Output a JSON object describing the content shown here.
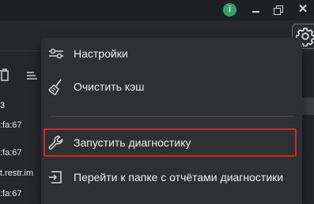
{
  "window": {
    "info_badge": "i",
    "controls": {
      "minimize_icon": "minimize-icon",
      "restore_icon": "restore-icon",
      "close_label": "✕"
    }
  },
  "toolbar": {
    "settings_icon": "gear-icon",
    "trash_icon": "trash-icon",
    "sort_icon": "sort-icon"
  },
  "side_list": {
    "lines": [
      {
        "text": "3"
      },
      {
        "text": ":fa:67"
      },
      {
        "text": ":fa:67"
      },
      {
        "text": "t.restr.im"
      },
      {
        "text": ":fa:67"
      }
    ]
  },
  "menu": {
    "items": [
      {
        "label": "Настройки",
        "icon": "sliders-icon"
      },
      {
        "label": "Очистить кэш",
        "icon": "broom-icon"
      },
      {
        "label": "Запустить диагностику",
        "icon": "wrench-icon",
        "highlighted": true
      },
      {
        "label": "Перейти к папке с отчётами диагностики",
        "icon": "folder-open-icon"
      }
    ]
  },
  "colors": {
    "highlight_border": "#d8232a",
    "menu_background": "#2d3134",
    "badge": "#2fa36b"
  }
}
